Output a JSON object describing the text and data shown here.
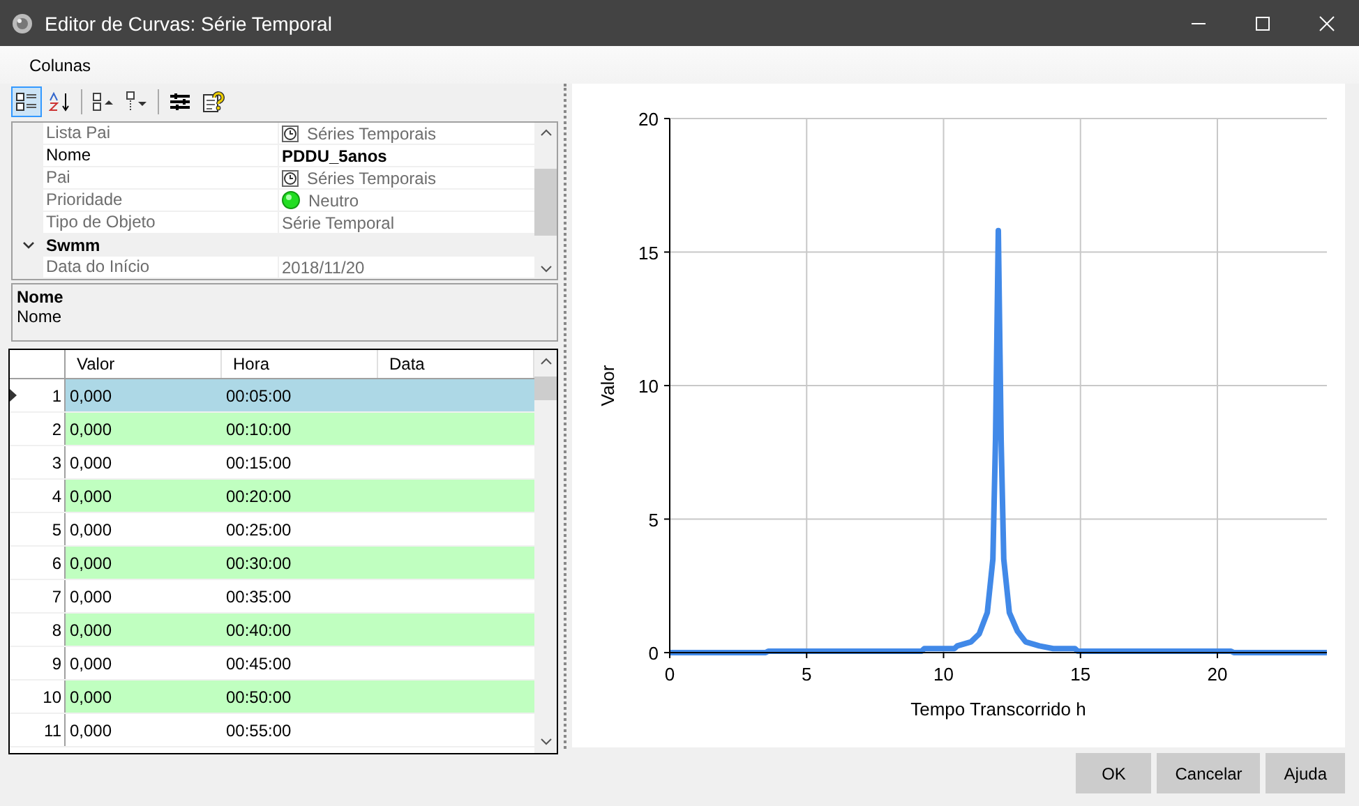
{
  "window": {
    "title": "Editor de Curvas: Série Temporal"
  },
  "menu": [
    {
      "label": "Colunas"
    }
  ],
  "toolbar": [
    {
      "kind": "categorized",
      "selected": true
    },
    {
      "kind": "alphabetical",
      "selected": false
    },
    {
      "kind": "expand",
      "selected": false
    },
    {
      "kind": "collapse",
      "selected": false
    },
    {
      "kind": "properties",
      "selected": false
    },
    {
      "kind": "help",
      "selected": false
    }
  ],
  "properties": [
    {
      "kind": "reference",
      "label": "Lista Pai",
      "value": "Séries Temporais",
      "readonly": true
    },
    {
      "kind": "property",
      "label": "Nome",
      "value": "PDDU_5anos",
      "readonly": false
    },
    {
      "kind": "reference",
      "label": "Pai",
      "value": "Séries Temporais",
      "readonly": true
    },
    {
      "kind": "priority",
      "label": "Prioridade",
      "value": "Neutro",
      "readonly": true
    },
    {
      "kind": "property",
      "label": "Tipo de Objeto",
      "value": "Série Temporal",
      "readonly": true
    },
    {
      "kind": "category",
      "label": "Swmm",
      "expanded": true
    },
    {
      "kind": "property",
      "label": "Data do Início",
      "value": "2018/11/20",
      "readonly": true
    }
  ],
  "description": {
    "title": "Nome",
    "text": "Nome"
  },
  "grid": {
    "columns": [
      "Valor",
      "Hora",
      "Data"
    ],
    "rows": [
      {
        "number": "1",
        "valor": "0,000",
        "hora": "00:05:00",
        "selected": true
      },
      {
        "number": "2",
        "valor": "0,000",
        "hora": "00:10:00",
        "selected": false
      },
      {
        "number": "3",
        "valor": "0,000",
        "hora": "00:15:00",
        "selected": false
      },
      {
        "number": "4",
        "valor": "0,000",
        "hora": "00:20:00",
        "selected": false
      },
      {
        "number": "5",
        "valor": "0,000",
        "hora": "00:25:00",
        "selected": false
      },
      {
        "number": "6",
        "valor": "0,000",
        "hora": "00:30:00",
        "selected": false
      },
      {
        "number": "7",
        "valor": "0,000",
        "hora": "00:35:00",
        "selected": false
      },
      {
        "number": "8",
        "valor": "0,000",
        "hora": "00:40:00",
        "selected": false
      },
      {
        "number": "9",
        "valor": "0,000",
        "hora": "00:45:00",
        "selected": false
      },
      {
        "number": "10",
        "valor": "0,000",
        "hora": "00:50:00",
        "selected": false
      },
      {
        "number": "11",
        "valor": "0,000",
        "hora": "00:55:00",
        "selected": false
      }
    ]
  },
  "chart": {
    "chart_data": {
      "type": "line",
      "xlabel": "Tempo Transcorrido h",
      "ylabel": "Valor",
      "x": [
        0,
        3.5,
        3.6,
        9.2,
        9.3,
        10.4,
        10.5,
        11,
        11.3,
        11.6,
        11.8,
        11.9,
        12,
        12.1,
        12.2,
        12.4,
        12.7,
        13,
        13.5,
        14,
        14.8,
        14.9,
        20.5,
        20.6,
        24
      ],
      "series": [
        {
          "color": "#4189e8",
          "values": [
            0,
            0,
            0.05,
            0.05,
            0.15,
            0.15,
            0.25,
            0.4,
            0.7,
            1.5,
            3.5,
            8,
            15.8,
            8,
            3.5,
            1.5,
            0.8,
            0.4,
            0.25,
            0.15,
            0.15,
            0.05,
            0.05,
            0,
            0
          ]
        }
      ],
      "grid": true,
      "xlim": [
        0,
        24
      ],
      "ylim": [
        0,
        20
      ],
      "xticks": [
        0,
        5,
        10,
        15,
        20
      ],
      "yticks": [
        0,
        5,
        10,
        15,
        20
      ]
    }
  },
  "buttons": [
    "OK",
    "Cancelar",
    "Ajuda"
  ]
}
